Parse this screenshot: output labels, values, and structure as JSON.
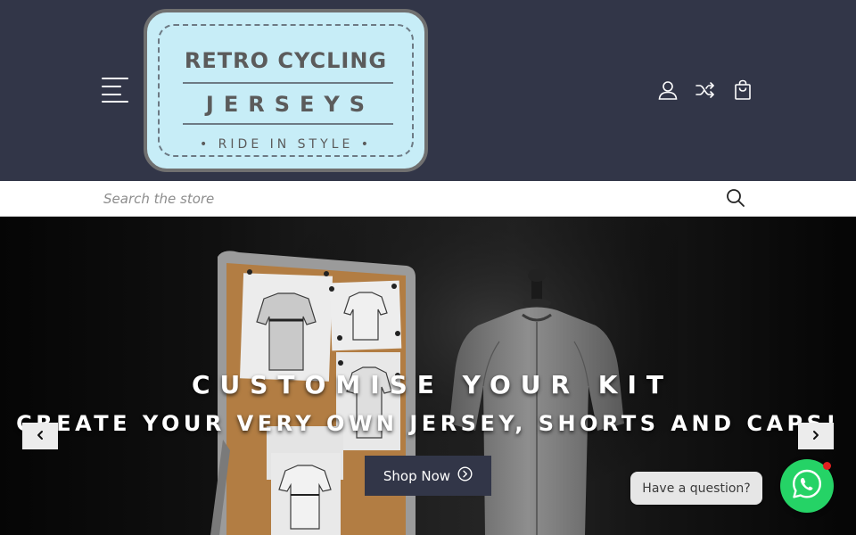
{
  "header": {
    "logo": {
      "line1": "RETRO CYCLING",
      "line2": "JERSEYS",
      "line3": "• RIDE IN STYLE •"
    },
    "icons": [
      "menu-icon",
      "user-icon",
      "shuffle-icon",
      "shopping-bag-icon"
    ]
  },
  "search": {
    "placeholder": "Search the store",
    "value": "",
    "icon": "search-icon"
  },
  "hero": {
    "title": "CUSTOMISE YOUR KIT",
    "subtitle": "CREATE YOUR VERY OWN JERSEY, SHORTS AND CAPS!",
    "button_label": "Shop Now",
    "button_icon": "circle-chevron-right-icon",
    "prev_icon": "chevron-left-icon",
    "next_icon": "chevron-right-icon"
  },
  "chat": {
    "bubble_text": "Have a question?",
    "icon": "whatsapp-icon",
    "notification": true
  },
  "colors": {
    "header_bg": "#323648",
    "logo_bg": "#c7edf7",
    "button_bg": "#323648",
    "whatsapp": "#25d366"
  }
}
